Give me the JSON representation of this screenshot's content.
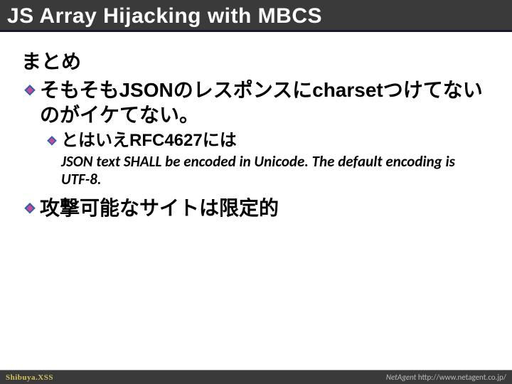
{
  "title": "JS Array Hijacking with MBCS",
  "summary_heading": "まとめ",
  "bullets": [
    {
      "text": "そもそもJSONのレスポンスにcharsetつけてないのがイケてない。"
    }
  ],
  "sub_bullets": [
    {
      "text": "とはいえRFC4627には"
    }
  ],
  "quote": "JSON text SHALL be encoded in Unicode. The default encoding is UTF-8.",
  "bullets2": [
    {
      "text": "攻撃可能なサイトは限定的"
    }
  ],
  "footer": {
    "left": "Shibuya.XSS",
    "right_brand": "NetAgent",
    "right_url": " http://www.netagent.co.jp/"
  },
  "colors": {
    "diamond_outer": "#2e5fa7",
    "diamond_inner": "#c44a9a"
  }
}
